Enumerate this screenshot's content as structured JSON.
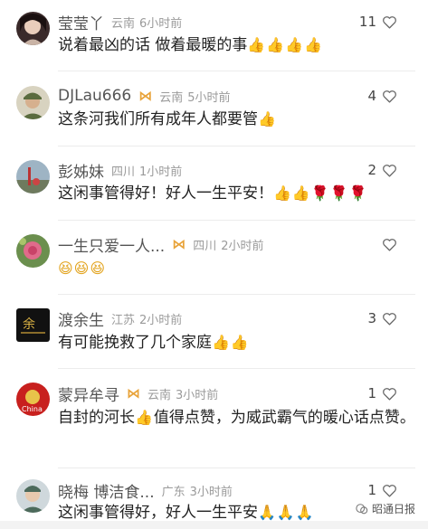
{
  "comments": [
    {
      "name": "莹莹丫",
      "region": "云南",
      "time": "6小时前",
      "likes": "11",
      "text": "说着最凶的话 做着最暖的事",
      "emoji": "👍👍👍👍",
      "badge": false,
      "rose": ""
    },
    {
      "name": "DJLau666",
      "region": "云南",
      "time": "5小时前",
      "likes": "4",
      "text": "这条河我们所有成年人都要管",
      "emoji": "👍",
      "badge": true,
      "rose": ""
    },
    {
      "name": "彭姊妹",
      "region": "四川",
      "time": "1小时前",
      "likes": "2",
      "text": "这闲事管得好！好人一生平安！",
      "emoji": "👍👍",
      "badge": false,
      "rose": "🌹🌹🌹"
    },
    {
      "name": "一生只爱一人...",
      "region": "四川",
      "time": "2小时前",
      "likes": "",
      "text": "",
      "emoji": "😆😆😆",
      "badge": true,
      "rose": ""
    },
    {
      "name": "渡余生",
      "region": "江苏",
      "time": "2小时前",
      "likes": "3",
      "text": "有可能挽救了几个家庭",
      "emoji": "👍👍",
      "badge": false,
      "rose": ""
    },
    {
      "name": "蒙异牟寻",
      "region": "云南",
      "time": "3小时前",
      "likes": "1",
      "text": "自封的河长",
      "emoji": "👍",
      "text2": "值得点赞，为威武霸气的暖心话点赞。",
      "badge": true,
      "rose": ""
    },
    {
      "name": "晓梅 博洁食...",
      "region": "广东",
      "time": "3小时前",
      "likes": "1",
      "text": "这闲事管得好，好人一生平安",
      "emoji": "🙏🙏🙏",
      "badge": false,
      "rose": ""
    }
  ],
  "watermark": "昭通日报",
  "colors": {
    "badge": "#e8a33a",
    "meta": "#9a9a9a",
    "text": "#222222",
    "divider": "#ececec"
  }
}
